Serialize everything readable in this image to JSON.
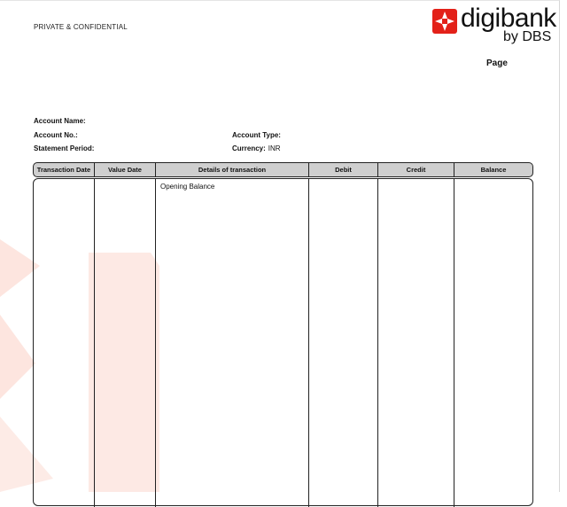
{
  "header": {
    "confidential": "PRIVATE & CONFIDENTIAL",
    "logo_word": "digibank",
    "logo_sub": "by DBS",
    "page_label": "Page"
  },
  "account": {
    "name_label": "Account Name:",
    "number_label": "Account No.:",
    "period_label": "Statement Period:",
    "type_label": "Account Type:",
    "currency_label": "Currency:",
    "currency_value": "INR"
  },
  "table": {
    "columns": [
      "Transaction Date",
      "Value Date",
      "Details of transaction",
      "Debit",
      "Credit",
      "Balance"
    ],
    "rows": [
      {
        "details": "Opening Balance"
      }
    ]
  },
  "colors": {
    "brand_red": "#e32119",
    "watermark": "#fde2dc",
    "header_fill": "#cfcfcf"
  }
}
